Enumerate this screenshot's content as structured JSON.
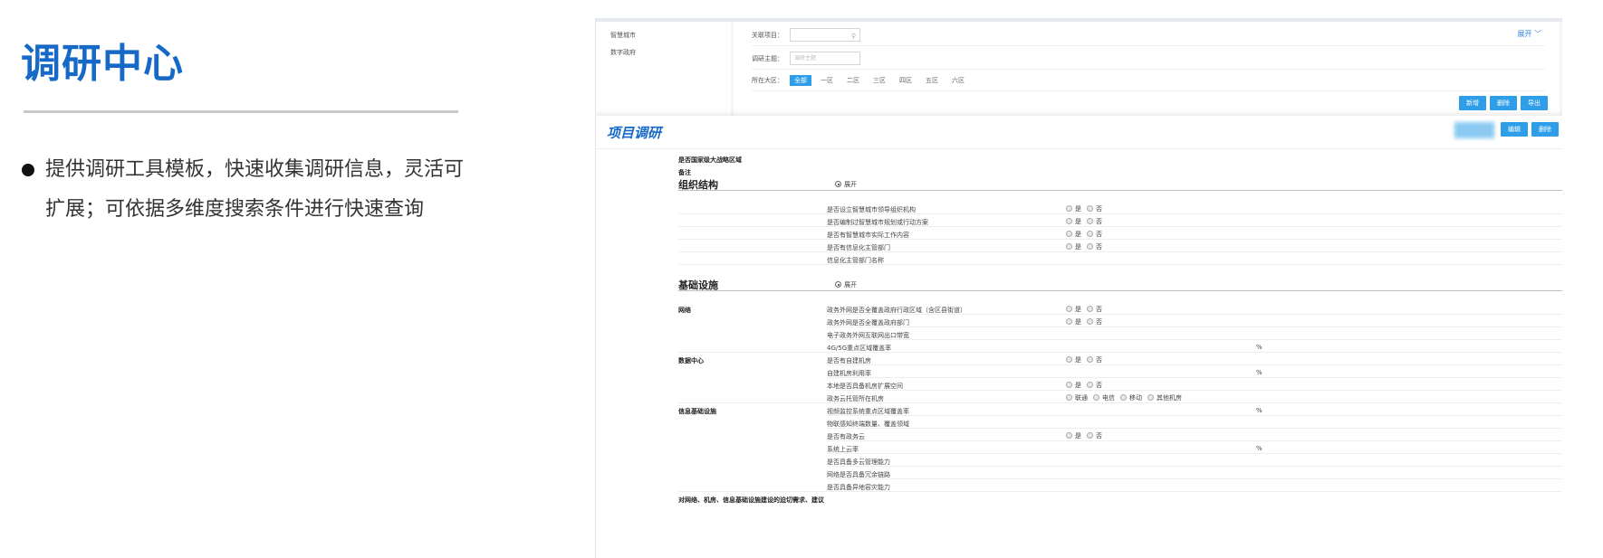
{
  "intro": {
    "title": "调研中心",
    "bullet_line1": "提供调研工具模板，快速收集调研信息，灵活可",
    "bullet_line2": "扩展；可依据多维度搜索条件进行快速查询"
  },
  "back_panel": {
    "nav_items": [
      "智慧城市",
      "数字政府"
    ],
    "filters": {
      "project_label": "关联项目：",
      "topic_label": "调研主题：",
      "topic_placeholder": "调研主题",
      "region_label": "所在大区：",
      "regions": [
        "全部",
        "一区",
        "二区",
        "三区",
        "四区",
        "五区",
        "六区"
      ],
      "selected_region": "全部"
    },
    "expand_label": "展开",
    "buttons": [
      "新增",
      "删除",
      "导出"
    ]
  },
  "project": {
    "title": "项目调研",
    "buttons": [
      "编辑",
      "删除"
    ],
    "top_fields": [
      "是否国家级大战略区域",
      "备注"
    ],
    "expand_label": "展开",
    "sections": [
      {
        "title": "组织结构",
        "items": [
          {
            "text": "是否设立智慧城市领导组织机构",
            "options": [
              "是",
              "否"
            ]
          },
          {
            "text": "是否编制过智慧城市规划或行动方案",
            "options": [
              "是",
              "否"
            ]
          },
          {
            "text": "是否有智慧城市实际工作内容",
            "options": [
              "是",
              "否"
            ]
          },
          {
            "text": "是否有信息化主管部门",
            "options": [
              "是",
              "否"
            ]
          },
          {
            "text": "信息化主管部门名称",
            "options": []
          }
        ]
      },
      {
        "title": "基础设施",
        "groups": [
          {
            "label": "网络",
            "items": [
              {
                "text": "政务外网是否全覆盖政府行政区域（含区县街道）",
                "options": [
                  "是",
                  "否"
                ]
              },
              {
                "text": "政务外网是否全覆盖政府部门",
                "options": [
                  "是",
                  "否"
                ]
              },
              {
                "text": "电子政务外网互联网出口带宽",
                "options": []
              },
              {
                "text": "4G/5G重点区域覆盖率",
                "options": [],
                "unit": "%"
              }
            ]
          },
          {
            "label": "数据中心",
            "items": [
              {
                "text": "是否有自建机房",
                "options": [
                  "是",
                  "否"
                ]
              },
              {
                "text": "自建机房利用率",
                "options": [],
                "unit": "%"
              },
              {
                "text": "本地是否具备机房扩展空间",
                "options": [
                  "是",
                  "否"
                ]
              },
              {
                "text": "政务云托管所在机房",
                "options": [
                  "联通",
                  "电信",
                  "移动",
                  "其他机房"
                ]
              }
            ]
          },
          {
            "label": "信息基础设施",
            "items": [
              {
                "text": "视频监控系统重点区域覆盖率",
                "options": [],
                "unit": "%"
              },
              {
                "text": "物联感知终端数量、覆盖领域",
                "options": []
              },
              {
                "text": "是否有政务云",
                "options": [
                  "是",
                  "否"
                ]
              },
              {
                "text": "系统上云率",
                "options": [],
                "unit": "%"
              },
              {
                "text": "是否具备多云管理能力",
                "options": []
              },
              {
                "text": "网络是否具备冗余链路",
                "options": []
              },
              {
                "text": "是否具备异地容灾能力",
                "options": []
              }
            ]
          }
        ]
      }
    ],
    "footer_text": "对网络、机房、信息基础设施建设的迫切需求、建议"
  }
}
